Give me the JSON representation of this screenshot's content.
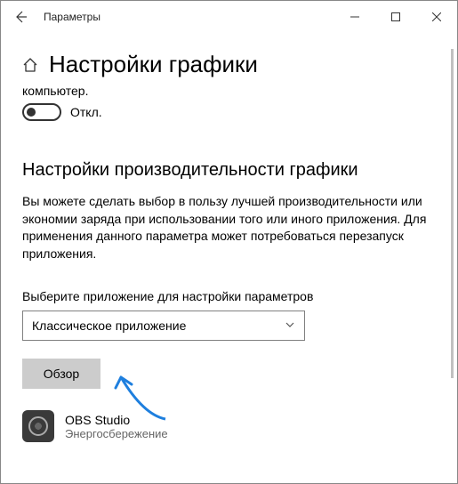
{
  "titlebar": {
    "title": "Параметры"
  },
  "page": {
    "heading": "Настройки графики",
    "truncated_line": "компьютер."
  },
  "toggle": {
    "state_label": "Откл."
  },
  "perf": {
    "heading": "Настройки производительности графики",
    "description": "Вы можете сделать выбор в пользу лучшей производительности или экономии заряда при использовании того или иного приложения. Для применения данного параметра может потребоваться перезапуск приложения.",
    "field_label": "Выберите приложение для настройки параметров",
    "combo_selected": "Классическое приложение",
    "browse_label": "Обзор"
  },
  "apps": [
    {
      "name": "OBS Studio",
      "mode": "Энергосбережение"
    }
  ]
}
